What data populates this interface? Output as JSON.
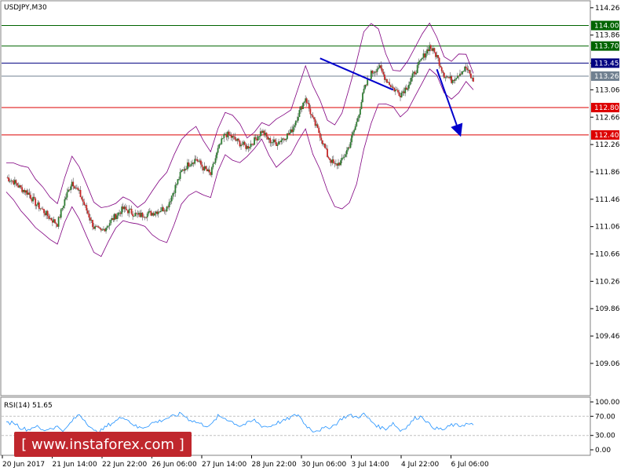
{
  "chart_data": [
    {
      "type": "candlestick",
      "symbol_label": "USDJPY,M30",
      "price_axis_ticks": [
        "114.26",
        "113.86",
        "113.45",
        "113.06",
        "112.66",
        "112.26",
        "111.86",
        "111.46",
        "111.06",
        "110.66",
        "110.26",
        "109.86",
        "109.46",
        "109.06"
      ],
      "ylim": [
        108.6,
        114.35
      ],
      "time_axis_labels": [
        "20 Jun 2017",
        "21 Jun 14:00",
        "22 Jun 22:00",
        "26 Jun 06:00",
        "27 Jun 14:00",
        "28 Jun 22:00",
        "30 Jun 06:00",
        "3 Jul 14:00",
        "4 Jul 22:00",
        "6 Jul 06:00"
      ],
      "close_series": [
        111.78,
        111.72,
        111.62,
        111.55,
        111.4,
        111.3,
        111.18,
        111.1,
        111.45,
        111.72,
        111.55,
        111.3,
        111.05,
        110.98,
        111.1,
        111.22,
        111.32,
        111.28,
        111.22,
        111.24,
        111.26,
        111.3,
        111.34,
        111.6,
        111.86,
        111.98,
        112.05,
        111.92,
        111.82,
        112.18,
        112.42,
        112.36,
        112.28,
        112.22,
        112.32,
        112.46,
        112.32,
        112.28,
        112.36,
        112.44,
        112.7,
        112.95,
        112.62,
        112.4,
        112.1,
        111.95,
        112.02,
        112.25,
        112.58,
        113.05,
        113.3,
        113.4,
        113.22,
        113.08,
        113.0,
        113.12,
        113.32,
        113.52,
        113.7,
        113.55,
        113.28,
        113.2,
        113.3,
        113.38,
        113.18
      ],
      "series": [
        {
          "name": "",
          "color": "#808080",
          "role": "candles"
        },
        {
          "name": "",
          "color": "#800080",
          "role": "bollinger-bands"
        }
      ],
      "horizontal_levels": [
        {
          "value": 114.0,
          "label": "114.00",
          "color": "#006400"
        },
        {
          "value": 113.7,
          "label": "113.70",
          "color": "#006400"
        },
        {
          "value": 113.45,
          "label": "113.45",
          "color": "#000080"
        },
        {
          "value": 113.26,
          "label": "113.26",
          "color": "#708090"
        },
        {
          "value": 112.8,
          "label": "112.80",
          "color": "#dd0000"
        },
        {
          "value": 112.4,
          "label": "112.40",
          "color": "#dd0000"
        }
      ],
      "annotations": [
        {
          "kind": "trendline",
          "color": "#0000cc",
          "from": [
            43,
            113.52
          ],
          "to": [
            53,
            113.06
          ]
        },
        {
          "kind": "arrow",
          "color": "#0000cc",
          "from": [
            59,
            113.36
          ],
          "to": [
            62,
            112.46
          ]
        }
      ],
      "grid": false
    },
    {
      "type": "line",
      "indicator_label": "RSI(14) 51.65",
      "ylim": [
        0,
        100
      ],
      "axis_ticks": [
        "100.00",
        "70.00",
        "30.00",
        "0.00"
      ],
      "levels": [
        70,
        30
      ],
      "values": [
        55,
        58,
        46,
        42,
        50,
        40,
        45,
        48,
        40,
        60,
        74,
        58,
        38,
        40,
        52,
        60,
        70,
        58,
        46,
        48,
        56,
        60,
        66,
        70,
        76,
        64,
        58,
        52,
        50,
        70,
        66,
        58,
        50,
        55,
        62,
        50,
        48,
        56,
        60,
        68,
        74,
        52,
        40,
        42,
        46,
        52,
        66,
        72,
        68,
        74,
        60,
        48,
        44,
        56,
        40,
        50,
        66,
        70,
        52,
        44,
        42,
        52,
        50,
        54,
        52
      ],
      "colors": {
        "line": "#1e90ff",
        "levels": "#c0c0c0"
      }
    }
  ],
  "watermark": {
    "text": "[ www.instaforex.com ]",
    "color": "#c0272d"
  }
}
